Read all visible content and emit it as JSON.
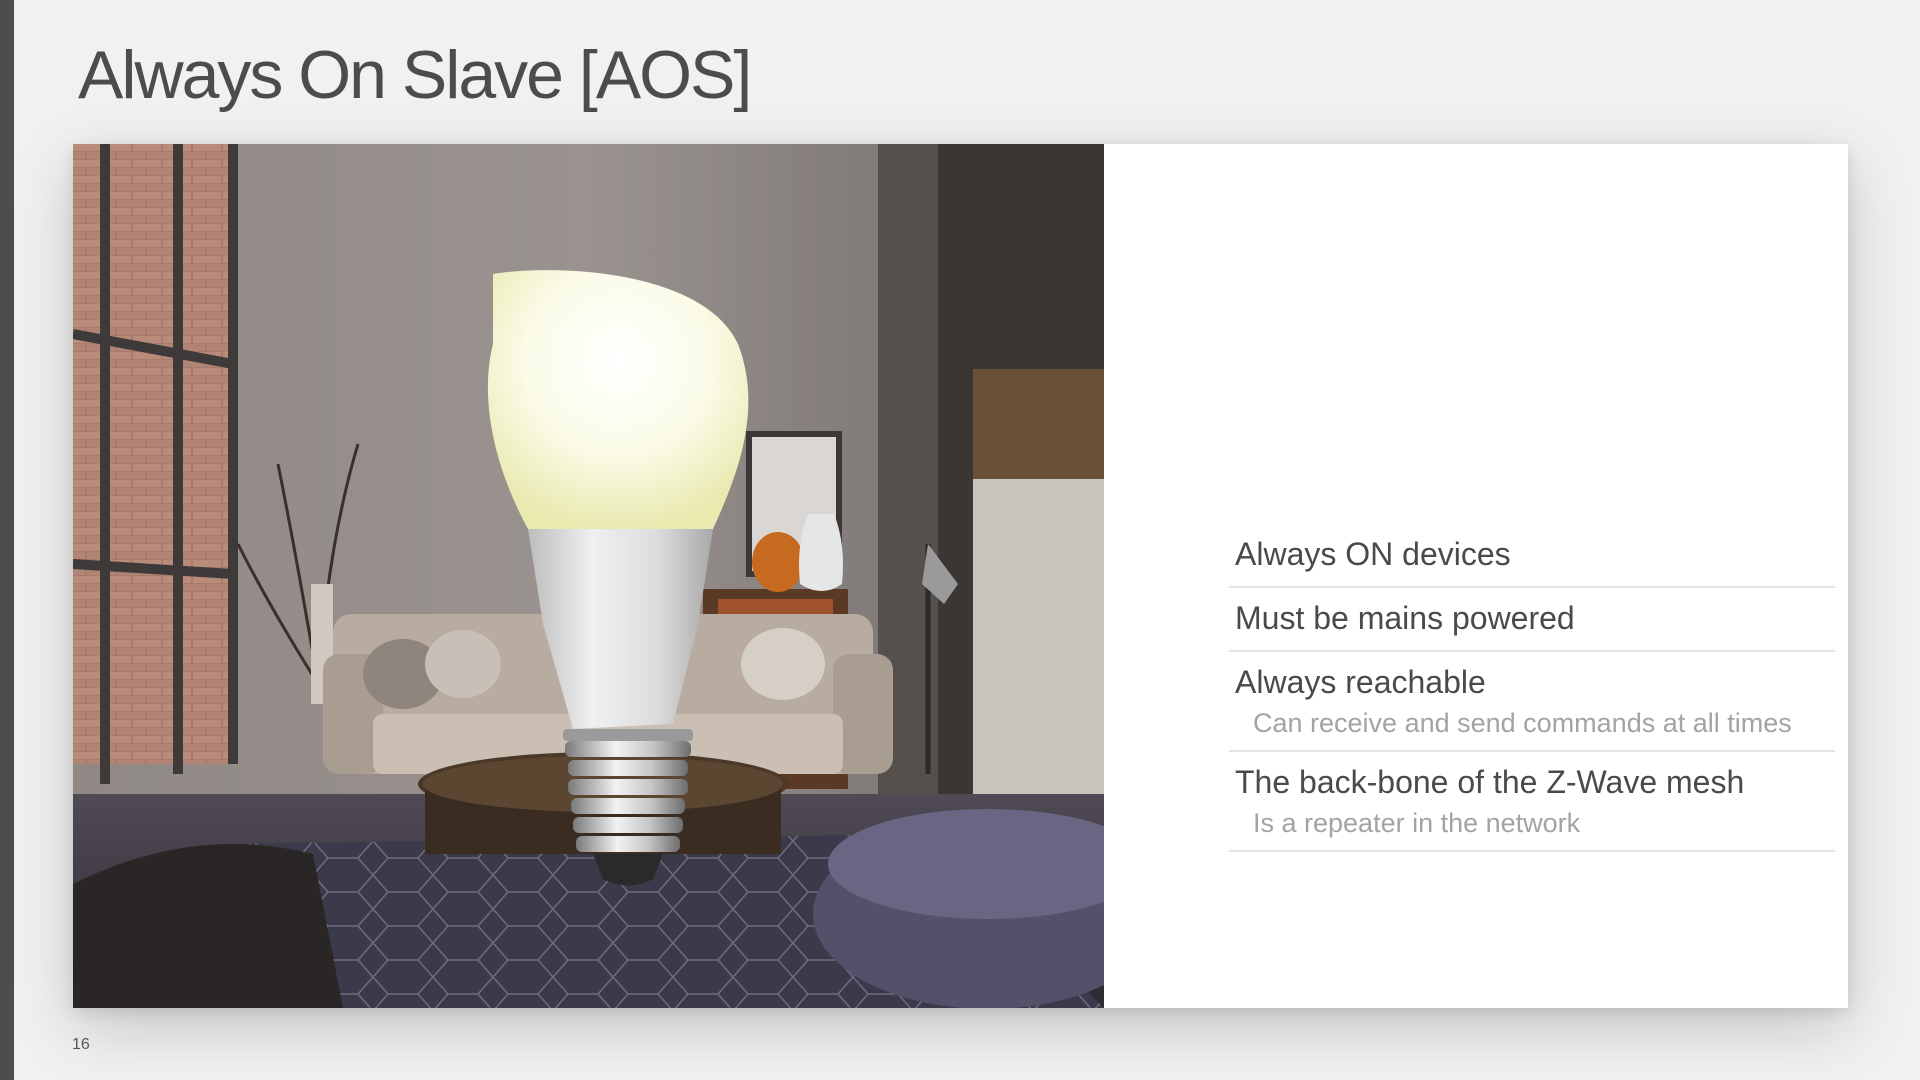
{
  "slide": {
    "title": "Always On Slave [AOS]",
    "page_number": "16"
  },
  "bullets": [
    {
      "main": "Always ON devices",
      "sub": ""
    },
    {
      "main": "Must be mains powered",
      "sub": ""
    },
    {
      "main": "Always reachable",
      "sub": "Can receive and send commands at all times"
    },
    {
      "main": "The back-bone of the Z-Wave mesh",
      "sub": "Is a repeater in the network"
    }
  ],
  "colors": {
    "title": "#4c4c4c",
    "bullet_main": "#4a4a4a",
    "bullet_sub": "#a3a3a3",
    "divider": "#e3e3e3",
    "background": "#f1f1f1"
  },
  "image": {
    "description_icon": "light-bulb-photo"
  }
}
